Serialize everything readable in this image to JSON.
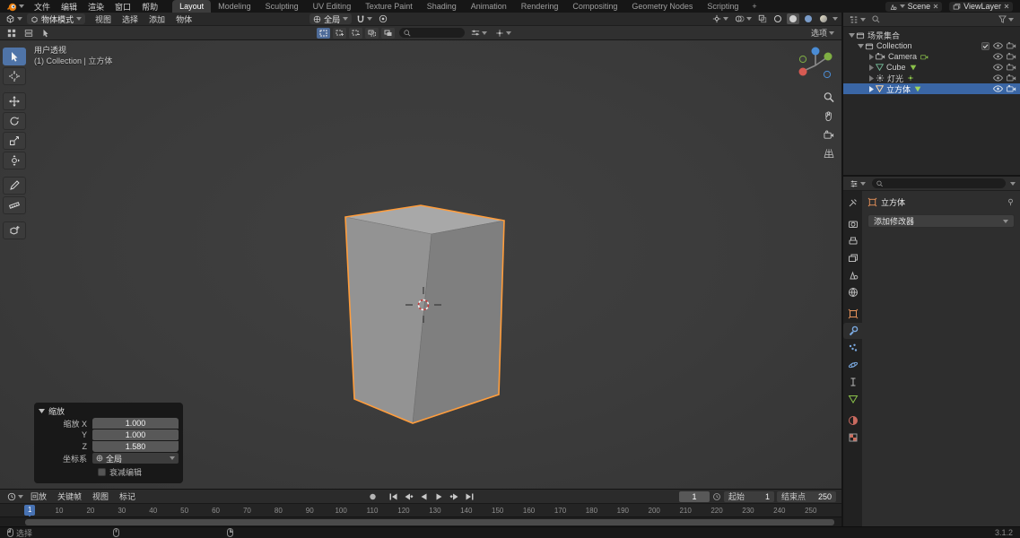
{
  "topbar": {
    "menus": [
      "文件",
      "编辑",
      "渲染",
      "窗口",
      "帮助"
    ],
    "workspaces": [
      "Layout",
      "Modeling",
      "Sculpting",
      "UV Editing",
      "Texture Paint",
      "Shading",
      "Animation",
      "Rendering",
      "Compositing",
      "Geometry Nodes",
      "Scripting"
    ],
    "active_workspace": "Layout",
    "add_workspace": "+",
    "scene": {
      "label": "Scene"
    },
    "view_layer": {
      "label": "ViewLayer"
    }
  },
  "viewport_header": {
    "mode": "物体模式",
    "menus": [
      "视图",
      "选择",
      "添加",
      "物体"
    ],
    "orientation": "全局",
    "shading_modes": [
      "wireframe",
      "solid",
      "material-preview",
      "rendered"
    ],
    "active_shading": "solid"
  },
  "tool_header": {
    "select_modes": [
      "new",
      "extend",
      "subtract",
      "invert",
      "intersect"
    ],
    "search_placeholder": "",
    "options": "选项"
  },
  "toolbar": {
    "tools": [
      "tweak-select",
      "cursor",
      "move",
      "rotate",
      "scale",
      "transform",
      "annotate",
      "measure",
      "add-cube"
    ],
    "active_tool": "tweak-select"
  },
  "viewport": {
    "view_label": "用户透视",
    "context_label": "(1) Collection | 立方体"
  },
  "operator_panel": {
    "title": "缩放",
    "fields": [
      {
        "label": "缩放 X",
        "value": "1.000"
      },
      {
        "label": "Y",
        "value": "1.000"
      },
      {
        "label": "Z",
        "value": "1.580"
      }
    ],
    "orientation_label": "坐标系",
    "orientation_value": "全局",
    "falloff_label": "衰减编辑",
    "falloff_checked": false
  },
  "outliner": {
    "scene_collection": "场景集合",
    "collection": "Collection",
    "objects": [
      "Camera",
      "Cube",
      "灯光",
      "立方体"
    ],
    "selected_object": "立方体"
  },
  "properties": {
    "search_placeholder": "",
    "object_name": "立方体",
    "add_modifier": "添加修改器",
    "tabs": [
      "tool",
      "render",
      "output",
      "view-layer",
      "scene",
      "world",
      "object",
      "modifiers",
      "particles",
      "physics",
      "constraints",
      "object-data",
      "material",
      "texture"
    ],
    "active_tab": "modifiers"
  },
  "timeline": {
    "menus": [
      "回放",
      "关键帧",
      "视图",
      "标记"
    ],
    "playback_buttons": [
      "record",
      "jump-start",
      "prev-keyframe",
      "play-reverse",
      "play",
      "next-keyframe",
      "jump-end"
    ],
    "current_frame": "1",
    "start_label": "起始",
    "start_value": "1",
    "end_label": "结束点",
    "end_value": "250",
    "ruler_ticks": [
      "10",
      "20",
      "30",
      "40",
      "50",
      "60",
      "70",
      "80",
      "90",
      "100",
      "110",
      "120",
      "130",
      "140",
      "150",
      "160",
      "170",
      "180",
      "190",
      "200",
      "210",
      "220",
      "230",
      "240",
      "250"
    ]
  },
  "statusbar": {
    "left_hint": "选择",
    "version": "3.1.2"
  },
  "colors": {
    "accent_blue": "#4772b3",
    "selection_orange": "#ff9d3c"
  }
}
